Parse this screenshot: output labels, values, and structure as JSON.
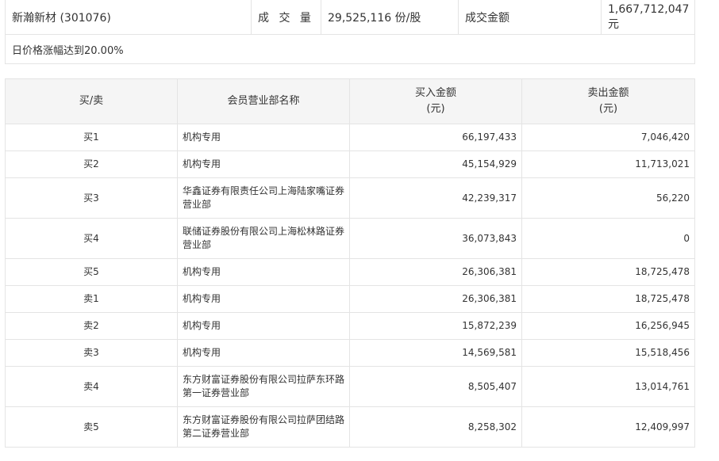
{
  "summary": {
    "stock_name": "新瀚新材 (301076)",
    "volume_label": "成 交 量",
    "volume_value": "29,525,116 份/股",
    "amount_label": "成交金额",
    "amount_value": "1,667,712,047 元",
    "note": "日价格涨幅达到20.00%"
  },
  "table": {
    "headers": {
      "side": "买/卖",
      "branch": "会员营业部名称",
      "buy_amount": "买入金额",
      "buy_unit": "(元)",
      "sell_amount": "卖出金额",
      "sell_unit": "(元)"
    },
    "rows": [
      {
        "side": "买1",
        "branch": "机构专用",
        "buy": "66,197,433",
        "sell": "7,046,420"
      },
      {
        "side": "买2",
        "branch": "机构专用",
        "buy": "45,154,929",
        "sell": "11,713,021"
      },
      {
        "side": "买3",
        "branch": "华鑫证券有限责任公司上海陆家嘴证券营业部",
        "buy": "42,239,317",
        "sell": "56,220"
      },
      {
        "side": "买4",
        "branch": "联储证券股份有限公司上海松林路证券营业部",
        "buy": "36,073,843",
        "sell": "0"
      },
      {
        "side": "买5",
        "branch": "机构专用",
        "buy": "26,306,381",
        "sell": "18,725,478"
      },
      {
        "side": "卖1",
        "branch": "机构专用",
        "buy": "26,306,381",
        "sell": "18,725,478"
      },
      {
        "side": "卖2",
        "branch": "机构专用",
        "buy": "15,872,239",
        "sell": "16,256,945"
      },
      {
        "side": "卖3",
        "branch": "机构专用",
        "buy": "14,569,581",
        "sell": "15,518,456"
      },
      {
        "side": "卖4",
        "branch": "东方财富证券股份有限公司拉萨东环路第一证券营业部",
        "buy": "8,505,407",
        "sell": "13,014,761"
      },
      {
        "side": "卖5",
        "branch": "东方财富证券股份有限公司拉萨团结路第二证券营业部",
        "buy": "8,258,302",
        "sell": "12,409,997"
      }
    ]
  }
}
